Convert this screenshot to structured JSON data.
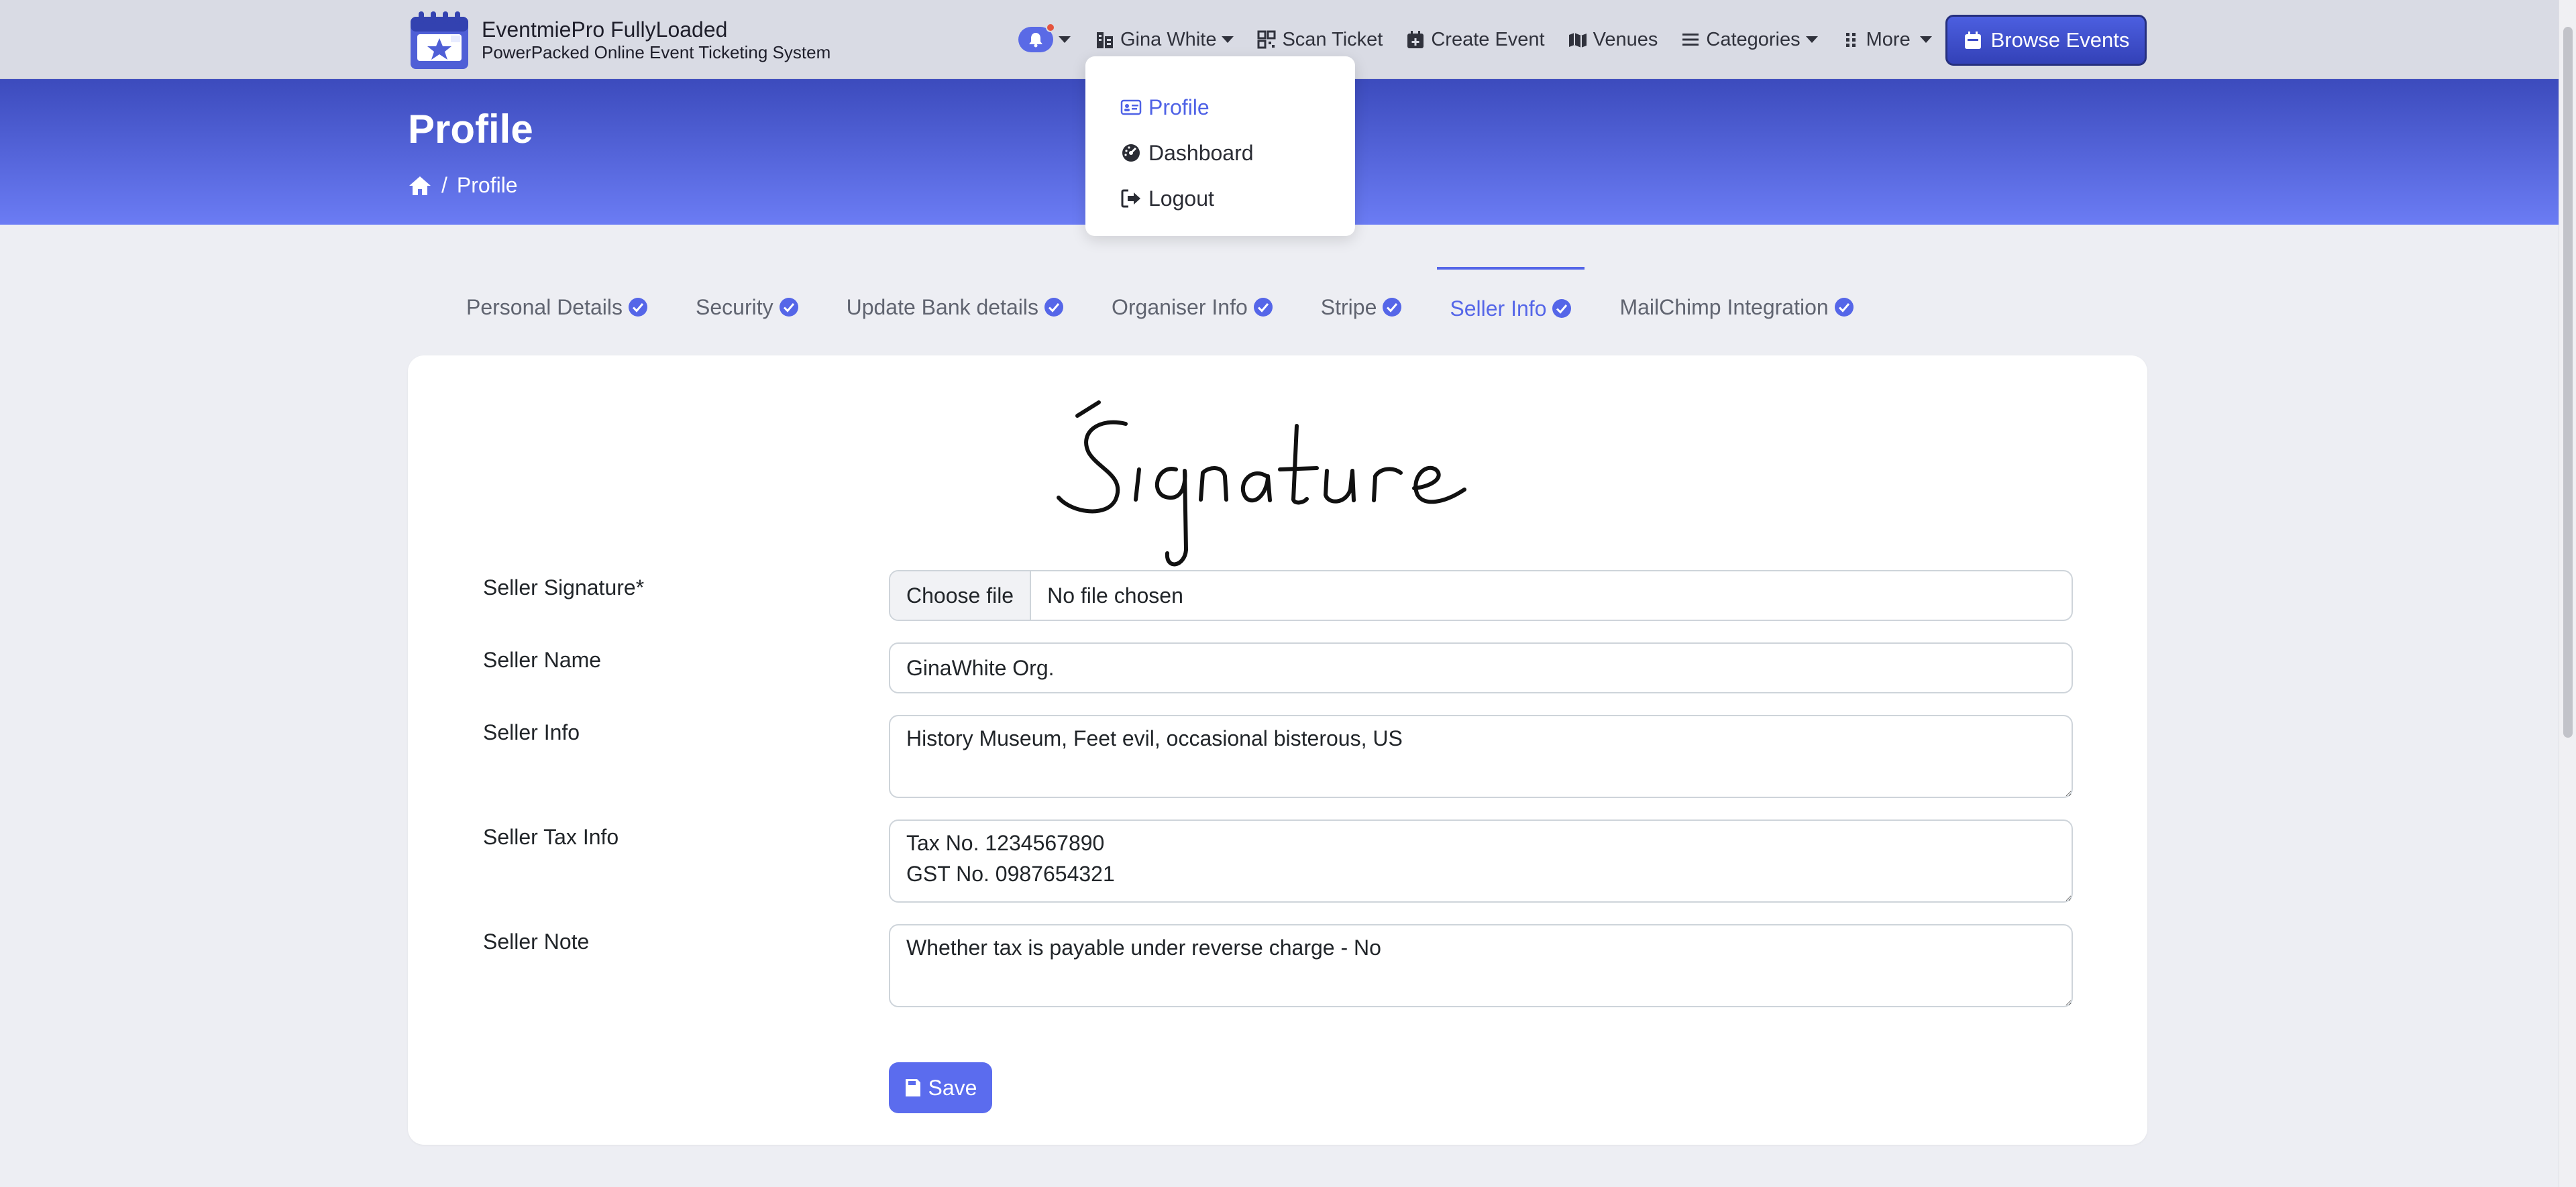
{
  "header": {
    "brand_title": "EventmiePro FullyLoaded",
    "brand_subtitle": "PowerPacked Online Event Ticketing System",
    "user_name": "Gina White",
    "nav": {
      "scan_ticket": "Scan Ticket",
      "create_event": "Create Event",
      "venues": "Venues",
      "categories": "Categories",
      "more": "More"
    },
    "browse_events": "Browse Events"
  },
  "user_menu": {
    "items": [
      {
        "label": "Profile",
        "icon": "id-card-icon",
        "active": true
      },
      {
        "label": "Dashboard",
        "icon": "dashboard-icon",
        "active": false
      },
      {
        "label": "Logout",
        "icon": "logout-icon",
        "active": false
      }
    ]
  },
  "hero": {
    "title": "Profile",
    "breadcrumb_separator": "/",
    "breadcrumb_current": "Profile"
  },
  "tabs": [
    {
      "label": "Personal Details",
      "active": false
    },
    {
      "label": "Security",
      "active": false
    },
    {
      "label": "Update Bank details",
      "active": false
    },
    {
      "label": "Organiser Info",
      "active": false
    },
    {
      "label": "Stripe",
      "active": false
    },
    {
      "label": "Seller Info",
      "active": true
    },
    {
      "label": "MailChimp Integration",
      "active": false
    }
  ],
  "form": {
    "signature_image_text": "Signature",
    "seller_signature_label": "Seller Signature*",
    "file_button": "Choose file",
    "file_status": "No file chosen",
    "seller_name_label": "Seller Name",
    "seller_name_value": "GinaWhite Org.",
    "seller_info_label": "Seller Info",
    "seller_info_value": "History Museum, Feet evil, occasional bisterous, US",
    "seller_tax_label": "Seller Tax Info",
    "seller_tax_value": "Tax No. 1234567890\nGST No. 0987654321",
    "seller_note_label": "Seller Note",
    "seller_note_value": "Whether tax is payable under reverse charge - No",
    "save_label": "Save"
  },
  "colors": {
    "accent": "#5566e8",
    "navbar_bg": "#d9dbe4",
    "hero_top": "#3c4bbd",
    "hero_bottom": "#6b7cf4",
    "notification_dot": "#e5533d"
  }
}
